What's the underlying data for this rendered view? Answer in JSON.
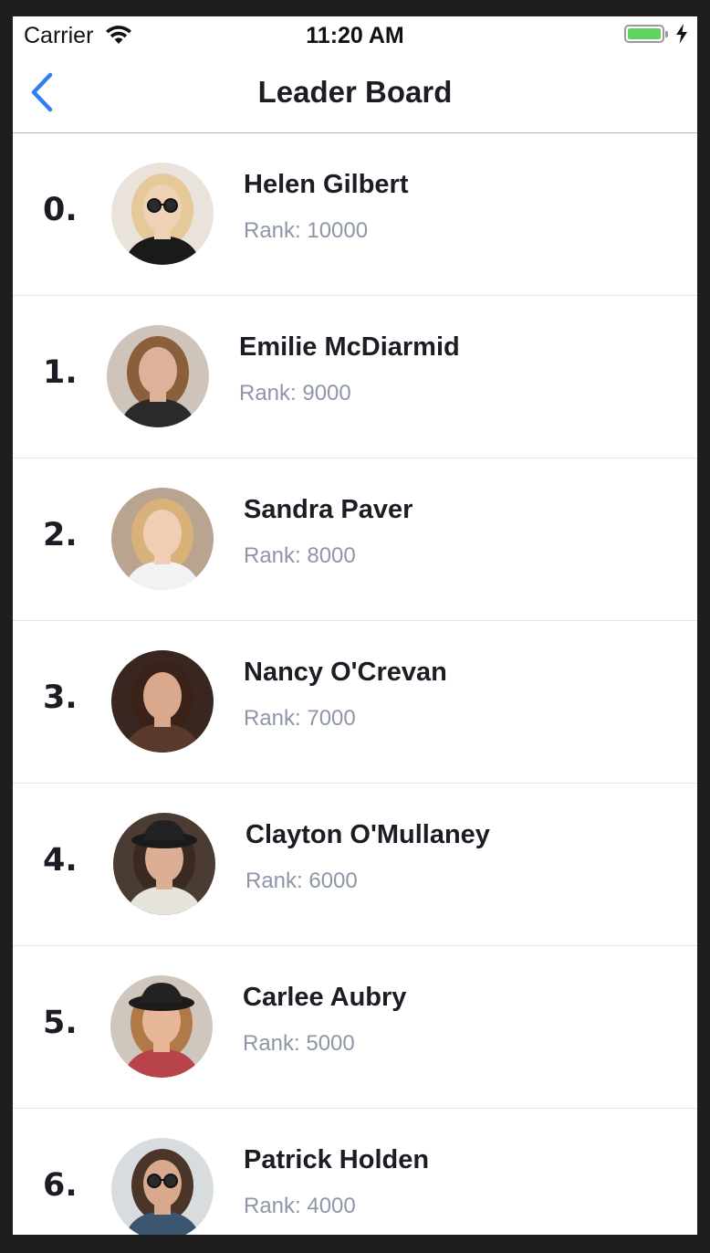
{
  "status_bar": {
    "carrier": "Carrier",
    "time": "11:20 AM",
    "battery_level": 1.0,
    "battery_color": "#5fd35f"
  },
  "nav": {
    "title": "Leader Board",
    "back_icon": "chevron-left-icon",
    "accent_color": "#2f7ef2"
  },
  "leaders": [
    {
      "position": "0.",
      "name": "Helen Gilbert",
      "rank": "Rank: 10000",
      "avatar": {
        "bg": "#e9e3dc",
        "skin": "#efd2b6",
        "hair": "#e6c998",
        "shirt": "#1a1a1a",
        "glasses": true,
        "hat": false
      }
    },
    {
      "position": "1.",
      "name": "Emilie McDiarmid",
      "rank": "Rank: 9000",
      "avatar": {
        "bg": "#cfc4b9",
        "skin": "#dcb29a",
        "hair": "#8b5e3c",
        "shirt": "#2a2a2a",
        "glasses": false,
        "hat": false
      }
    },
    {
      "position": "2.",
      "name": "Sandra Paver",
      "rank": "Rank: 8000",
      "avatar": {
        "bg": "#b9a48f",
        "skin": "#f0cdb5",
        "hair": "#d9b27a",
        "shirt": "#f2f2f2",
        "glasses": false,
        "hat": false
      }
    },
    {
      "position": "3.",
      "name": "Nancy O'Crevan",
      "rank": "Rank: 7000",
      "avatar": {
        "bg": "#3a2620",
        "skin": "#d9a88d",
        "hair": "#3b2218",
        "shirt": "#5a3a2c",
        "glasses": false,
        "hat": false
      }
    },
    {
      "position": "4.",
      "name": "Clayton O'Mullaney",
      "rank": "Rank: 6000",
      "avatar": {
        "bg": "#4a3b33",
        "skin": "#dcae93",
        "hair": "#3a2a20",
        "shirt": "#e6e2dc",
        "glasses": false,
        "hat": true
      }
    },
    {
      "position": "5.",
      "name": "Carlee Aubry",
      "rank": "Rank: 5000",
      "avatar": {
        "bg": "#cfc6bd",
        "skin": "#e8b698",
        "hair": "#b07a48",
        "shirt": "#b8434a",
        "glasses": false,
        "hat": true
      }
    },
    {
      "position": "6.",
      "name": "Patrick Holden",
      "rank": "Rank: 4000",
      "avatar": {
        "bg": "#d9dcde",
        "skin": "#d8a98c",
        "hair": "#4a3528",
        "shirt": "#3c5670",
        "glasses": true,
        "hat": false
      }
    }
  ]
}
